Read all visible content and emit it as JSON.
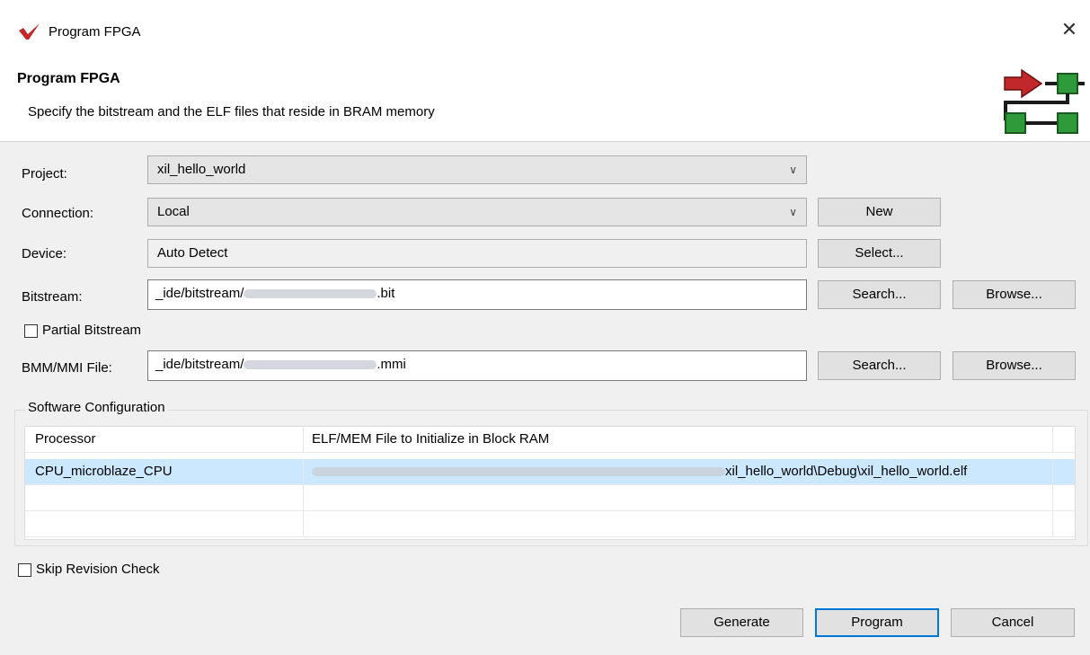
{
  "window": {
    "title": "Program FPGA"
  },
  "header": {
    "title": "Program FPGA",
    "description": "Specify the bitstream and the ELF files that reside in BRAM memory"
  },
  "form": {
    "project_label": "Project:",
    "project_value": "xil_hello_world",
    "connection_label": "Connection:",
    "connection_value": "Local",
    "new_button": "New",
    "device_label": "Device:",
    "device_value": "Auto Detect",
    "select_button": "Select...",
    "bitstream_label": "Bitstream:",
    "bitstream_prefix": "_ide/bitstream/",
    "bitstream_suffix": ".bit",
    "search_button": "Search...",
    "browse_button": "Browse...",
    "partial_bitstream_label": "Partial Bitstream",
    "partial_bitstream_checked": false,
    "bmm_label": "BMM/MMI File:",
    "bmm_prefix": "_ide/bitstream/",
    "bmm_suffix": ".mmi"
  },
  "software": {
    "group_title": "Software Configuration",
    "columns": [
      "Processor",
      "ELF/MEM File to Initialize in Block RAM"
    ],
    "rows": [
      {
        "processor": "CPU_microblaze_CPU",
        "file_suffix": "xil_hello_world\\Debug\\xil_hello_world.elf",
        "selected": true
      }
    ]
  },
  "skip_revision_check": {
    "label": "Skip Revision Check",
    "checked": false
  },
  "footer": {
    "generate": "Generate",
    "program": "Program",
    "cancel": "Cancel"
  },
  "colors": {
    "accent": "#0078d7",
    "selection": "#cce8ff",
    "icon_arrow": "#c0282b",
    "icon_block": "#2e9a3a"
  }
}
